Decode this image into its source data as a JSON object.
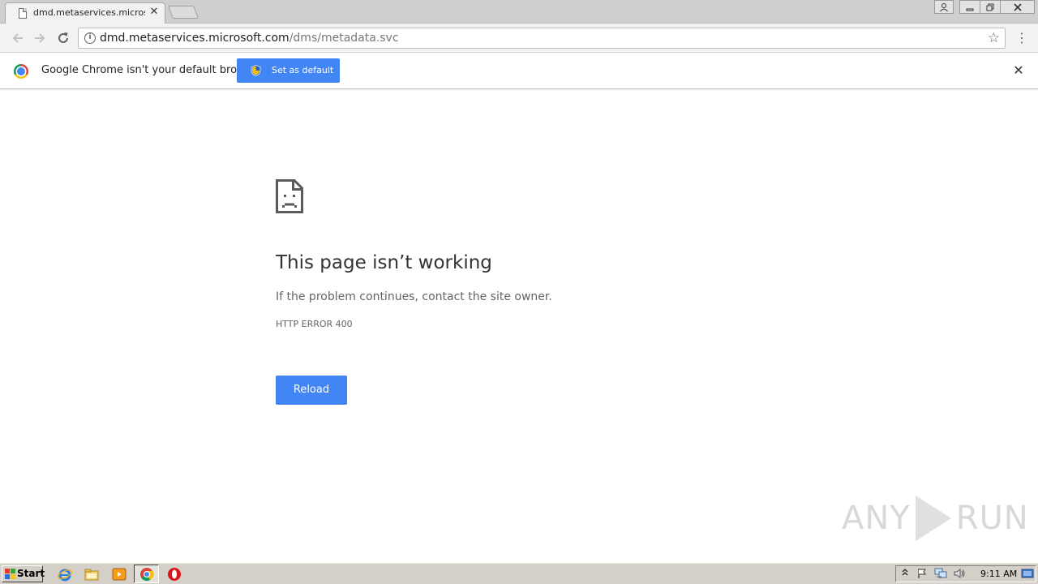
{
  "browser": {
    "tab_title": "dmd.metaservices.microsoft",
    "tab_close_glyph": "✕",
    "url_host": "dmd.metaservices.microsoft.com",
    "url_path": "/dms/metadata.svc"
  },
  "infobar": {
    "message": "Google Chrome isn't your default browser",
    "set_default_label": "Set as default",
    "close_glyph": "✕"
  },
  "error_page": {
    "title": "This page isn’t working",
    "description": "If the problem continues, contact the site owner.",
    "code": "HTTP ERROR 400",
    "reload_label": "Reload"
  },
  "watermark": {
    "left": "ANY",
    "right": "RUN"
  },
  "taskbar": {
    "start_label": "Start",
    "clock": "9:11 AM"
  },
  "icons": {
    "back": "arrow-left-icon",
    "forward": "arrow-right-icon",
    "reload": "reload-icon",
    "info": "info-icon",
    "star": "star-icon",
    "menu": "kebab-menu-icon",
    "sad_page": "sad-page-icon",
    "shield": "shield-icon"
  },
  "colors": {
    "accent_blue": "#4285f4",
    "title_text": "#333333",
    "body_text": "#646464"
  }
}
